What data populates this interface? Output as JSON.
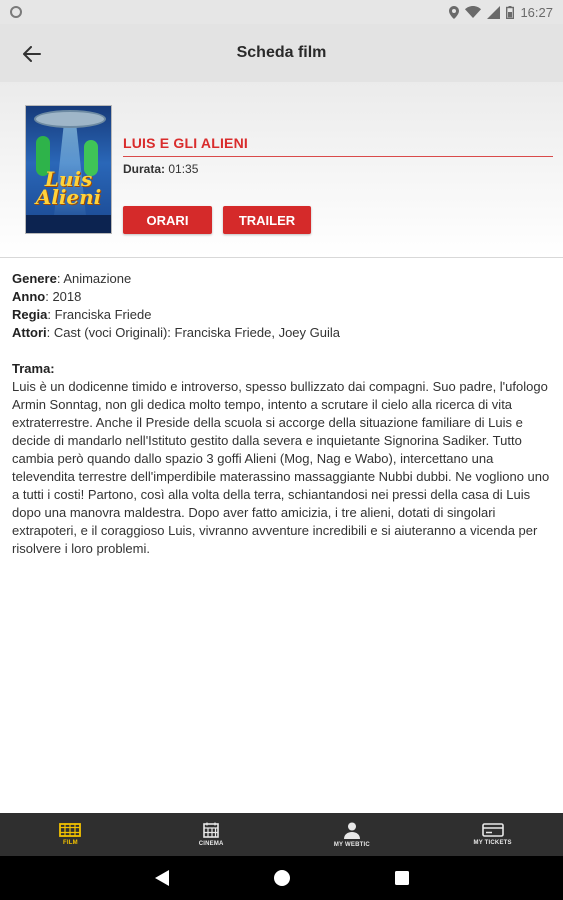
{
  "status": {
    "time": "16:27"
  },
  "appbar": {
    "title": "Scheda film"
  },
  "movie": {
    "title": "LUIS E GLI ALIENI",
    "poster_text": "Luis Alieni",
    "durata_label": "Durata:",
    "durata_value": " 01:35",
    "btn_orari": "ORARI",
    "btn_trailer": "TRAILER"
  },
  "details": {
    "genere_label": "Genere",
    "genere_value": ": Animazione",
    "anno_label": "Anno",
    "anno_value": ": 2018",
    "regia_label": "Regia",
    "regia_value": ": Franciska Friede",
    "attori_label": "Attori",
    "attori_value": ": Cast (voci Originali): Franciska Friede, Joey Guila",
    "trama_label": "Trama:",
    "trama_text": "Luis è un dodicenne timido e introverso, spesso bullizzato dai compagni. Suo padre, l'ufologo Armin Sonntag, non gli dedica molto tempo, intento a scrutare il cielo alla ricerca di vita extraterrestre. Anche il Preside della scuola si accorge della situazione familiare di Luis e decide di mandarlo nell'Istituto gestito dalla severa e inquietante Signorina Sadiker. Tutto cambia però quando dallo spazio 3 goffi Alieni (Mog, Nag e Wabo), intercettano una televendita terrestre dell'imperdibile materassino massaggiante Nubbi dubbi. Ne vogliono uno a tutti i costi! Partono, così alla volta della terra, schiantandosi nei pressi della casa di Luis dopo una manovra maldestra. Dopo aver fatto amicizia, i tre alieni, dotati di singolari extrapoteri, e il coraggioso Luis, vivranno avventure incredibili e si aiuteranno a vicenda per risolvere i loro problemi."
  },
  "nav": {
    "film": "FILM",
    "cinema": "CINEMA",
    "mywebtic": "MY WEBTIC",
    "mytickets": "MY TICKETS"
  },
  "colors": {
    "accent_red": "#d52a2a",
    "nav_active": "#f2c100",
    "nav_bg": "#2f2f2f"
  },
  "icons": {
    "status": [
      "location-icon",
      "wifi-icon",
      "signal-icon",
      "battery-icon"
    ],
    "nav": [
      "film-icon",
      "calendar-icon",
      "person-icon",
      "ticket-icon"
    ],
    "system": [
      "back-triangle-icon",
      "home-circle-icon",
      "recents-square-icon"
    ]
  }
}
